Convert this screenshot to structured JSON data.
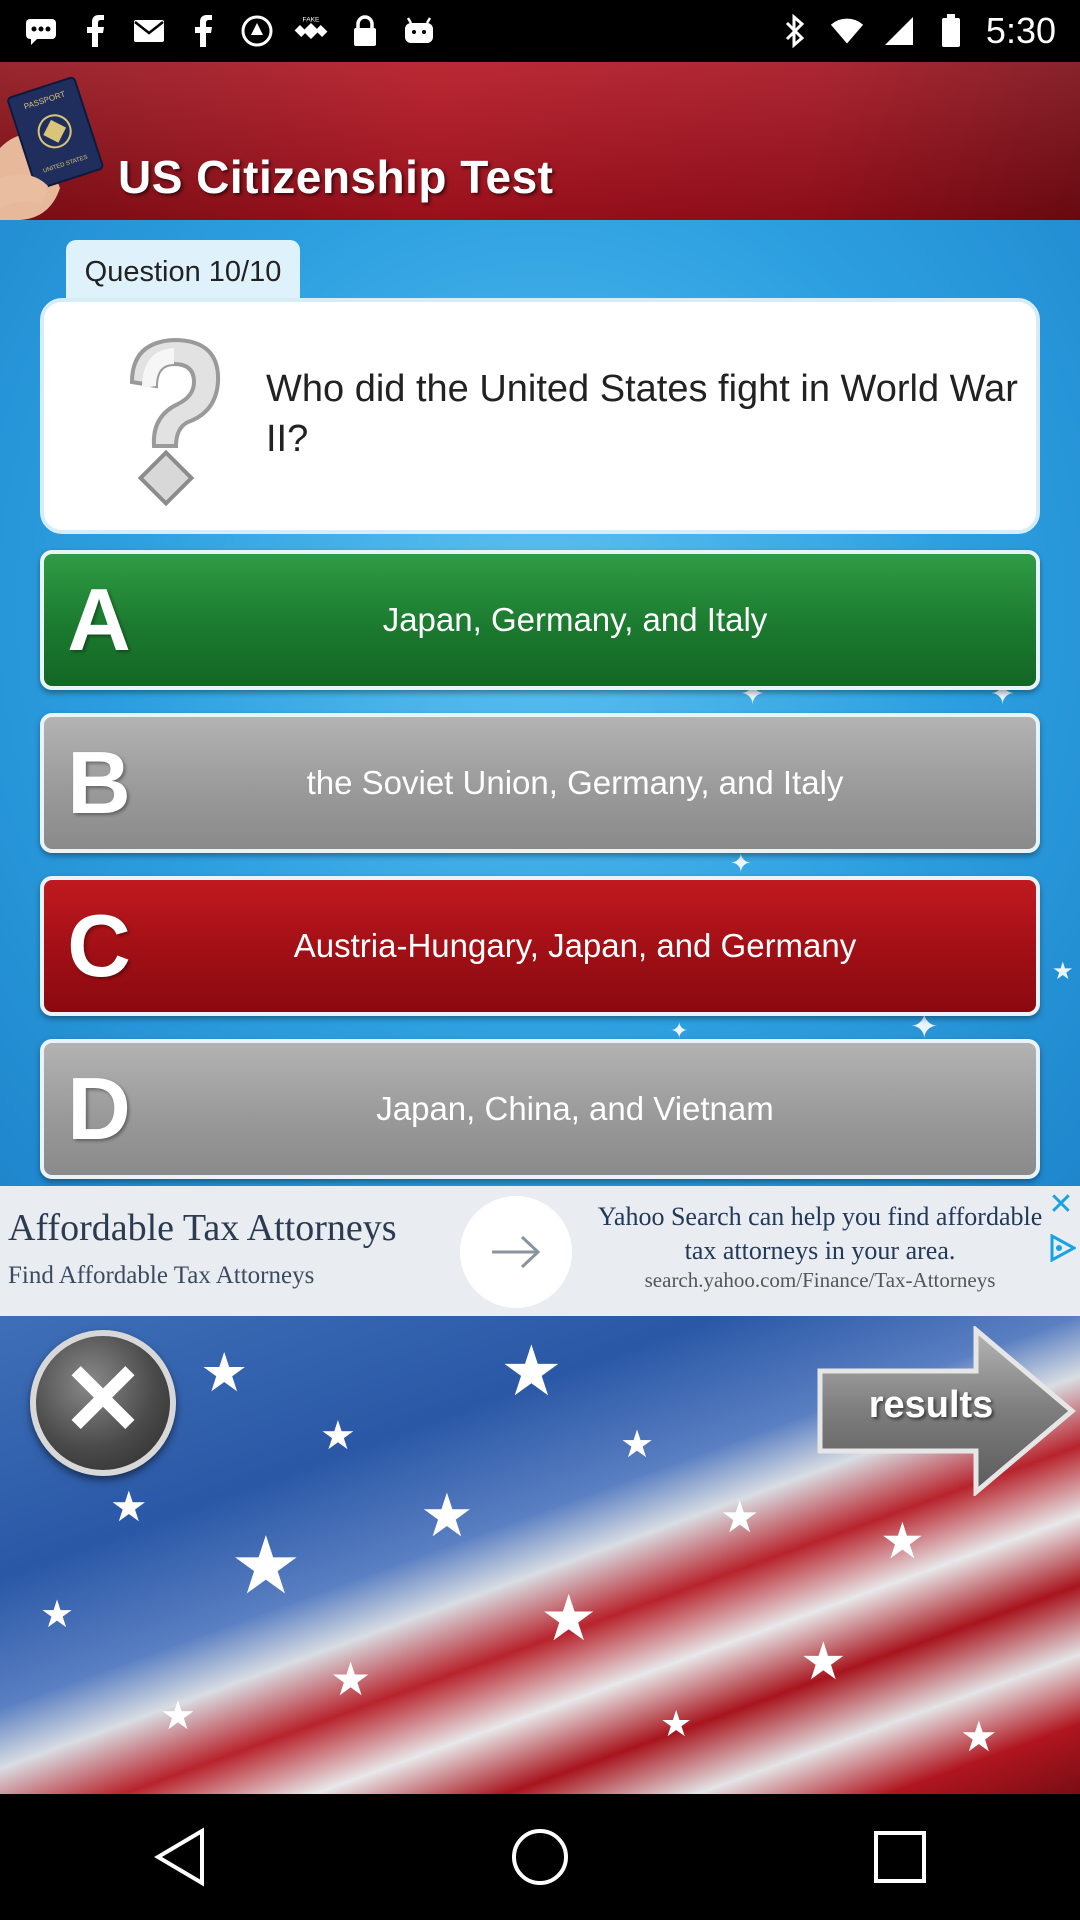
{
  "status_bar": {
    "time": "5:30",
    "icons_left": [
      "chat-icon",
      "facebook-icon",
      "mail-icon",
      "facebook-icon",
      "app-icon",
      "fake-gps-icon",
      "lock-icon",
      "android-icon"
    ],
    "icons_right": [
      "bluetooth-icon",
      "wifi-icon",
      "signal-icon",
      "battery-icon"
    ]
  },
  "header": {
    "title": "US Citizenship Test"
  },
  "quiz": {
    "progress_label": "Question 10/10",
    "question": "Who did the United States fight in World War II?",
    "answers": [
      {
        "letter": "A",
        "text": "Japan, Germany, and Italy",
        "state": "correct",
        "color": "#1b7a2f"
      },
      {
        "letter": "B",
        "text": "the Soviet Union, Germany, and Italy",
        "state": "neutral",
        "color": "#9a9a9a"
      },
      {
        "letter": "C",
        "text": "Austria-Hungary, Japan, and Germany",
        "state": "wrong",
        "color": "#a00f15"
      },
      {
        "letter": "D",
        "text": "Japan, China, and Vietnam",
        "state": "neutral",
        "color": "#9a9a9a"
      }
    ]
  },
  "ad": {
    "title": "Affordable Tax Attorneys",
    "subtitle": "Find Affordable Tax Attorneys",
    "description": "Yahoo Search can help you find affordable tax attorneys in your area.",
    "url": "search.yahoo.com/Finance/Tax-Attorneys"
  },
  "footer": {
    "results_label": "results"
  },
  "navbar": {
    "buttons": [
      "back",
      "home",
      "recents"
    ]
  }
}
